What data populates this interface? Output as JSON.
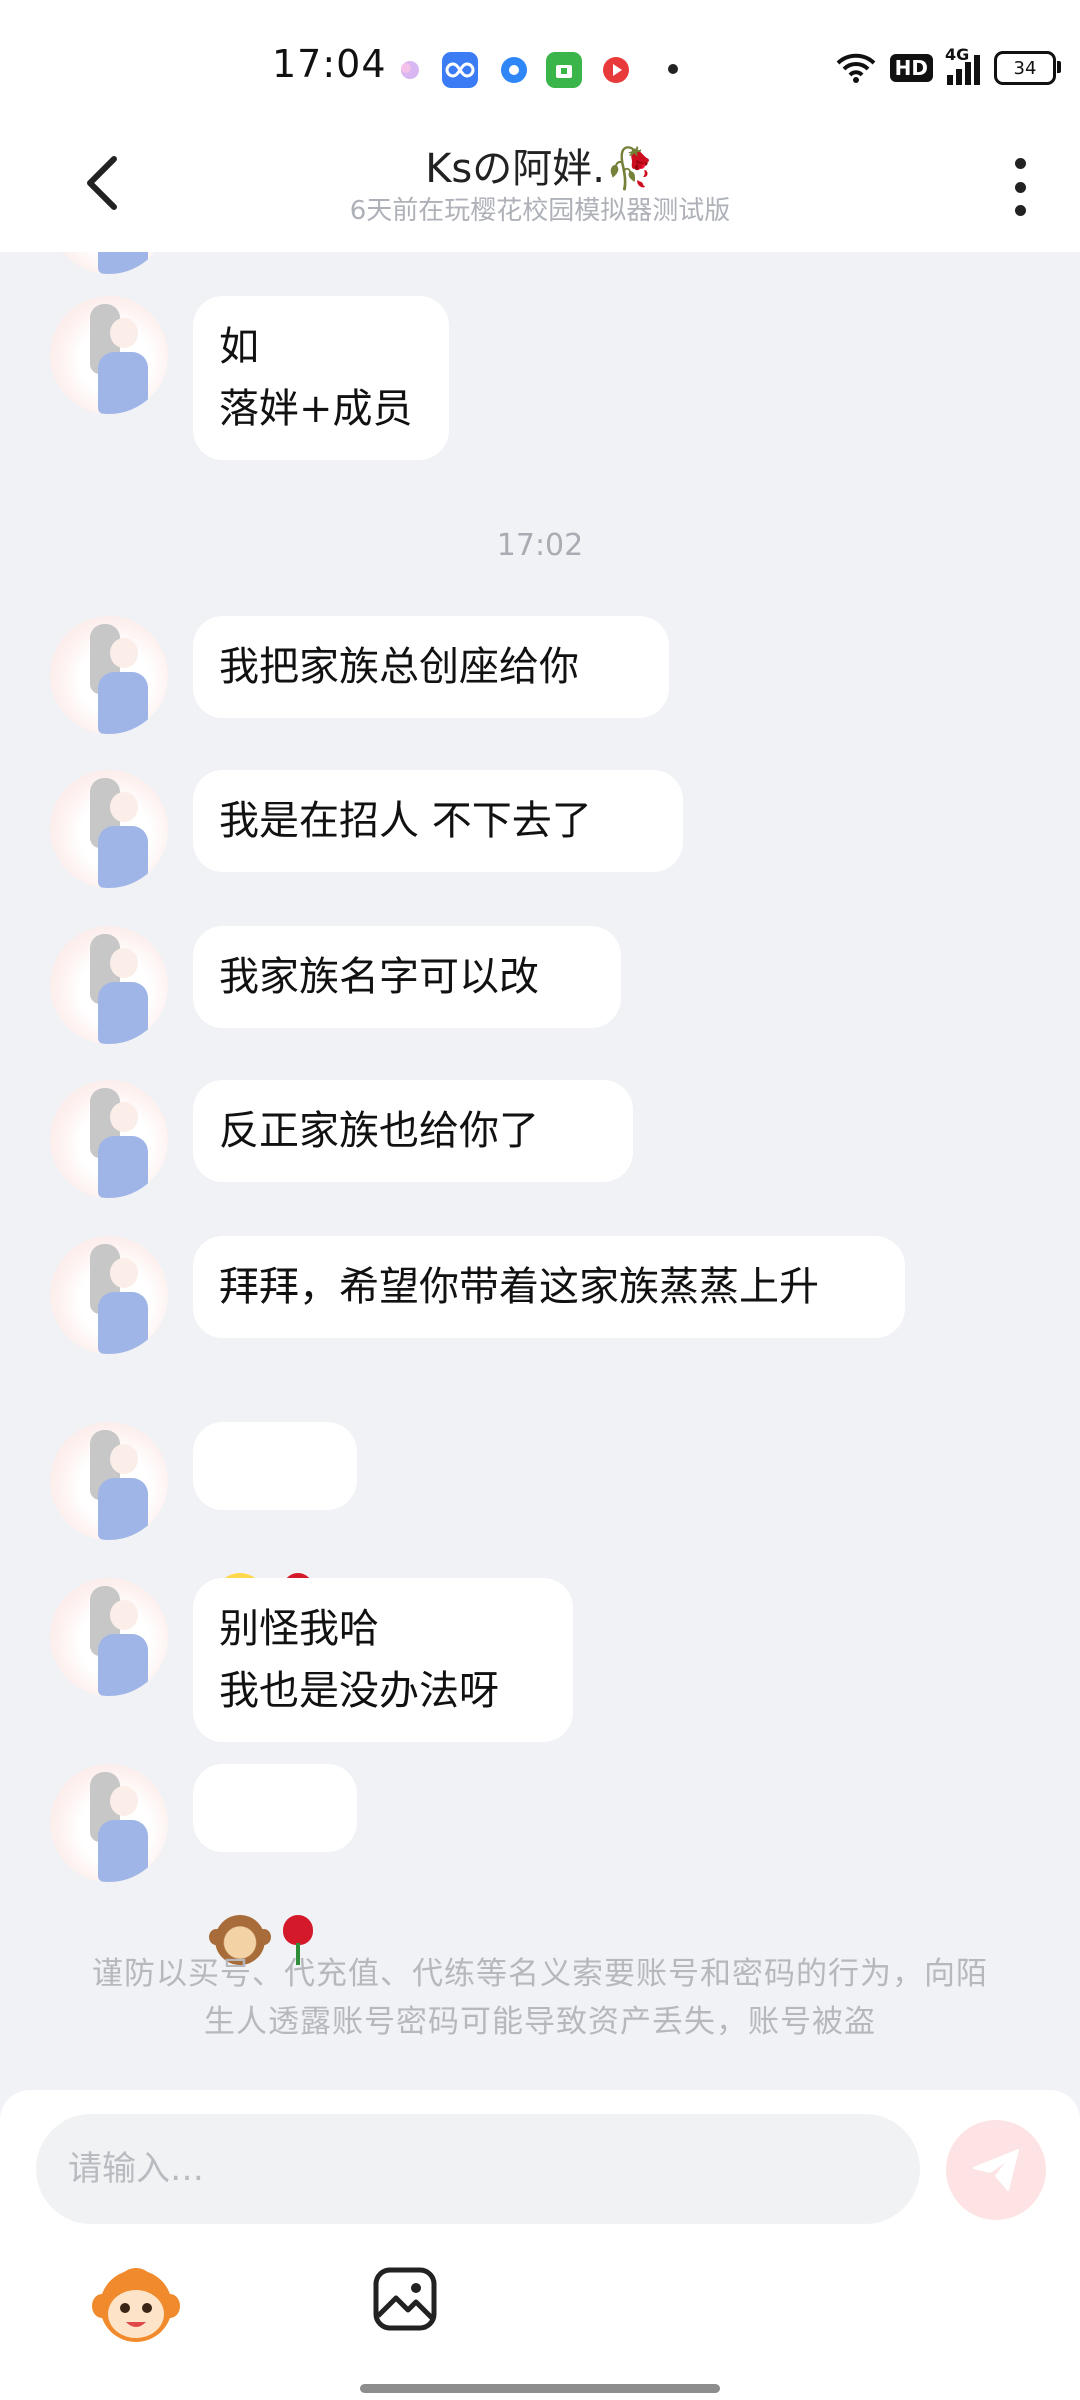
{
  "status_bar": {
    "time": "17:04",
    "network": "4G",
    "hd_label": "HD",
    "battery": "34",
    "app_icons": [
      "petal-icon",
      "loop-app-icon",
      "circle-app-icon",
      "shop-app-icon",
      "video-app-icon"
    ]
  },
  "header": {
    "title": "Ksの阿姅.🥀",
    "subtitle": "6天前在玩樱花校园模拟器测试版"
  },
  "messages": [
    {
      "type": "text",
      "text": "如\n落姅+成员"
    },
    {
      "type": "time",
      "text": "17:02"
    },
    {
      "type": "text",
      "text": "我把家族总创座给你"
    },
    {
      "type": "text",
      "text": "我是在招人 不下去了"
    },
    {
      "type": "text",
      "text": "我家族名字可以改"
    },
    {
      "type": "text",
      "text": "反正家族也给你了"
    },
    {
      "type": "text",
      "text": "拜拜，希望你带着这家族蒸蒸上升"
    },
    {
      "type": "emoji",
      "emojis": [
        "face-with-tears-of-joy",
        "rose"
      ],
      "text": "😂🌹"
    },
    {
      "type": "text",
      "text": "别怪我哈\n我也是没办法呀"
    },
    {
      "type": "emoji",
      "emojis": [
        "monkey",
        "rose"
      ],
      "text": "🐒🌹"
    }
  ],
  "notice": "谨防以买号、代充值、代练等名义索要账号和密码的行为，向陌生人透露账号密码可能导致资产丢失，账号被盗",
  "composer": {
    "placeholder": "请输入…"
  },
  "colors": {
    "background": "#f1f2f5",
    "bubble": "#ffffff",
    "send_button": "#fde3e4",
    "accent": "#f25a5a"
  }
}
